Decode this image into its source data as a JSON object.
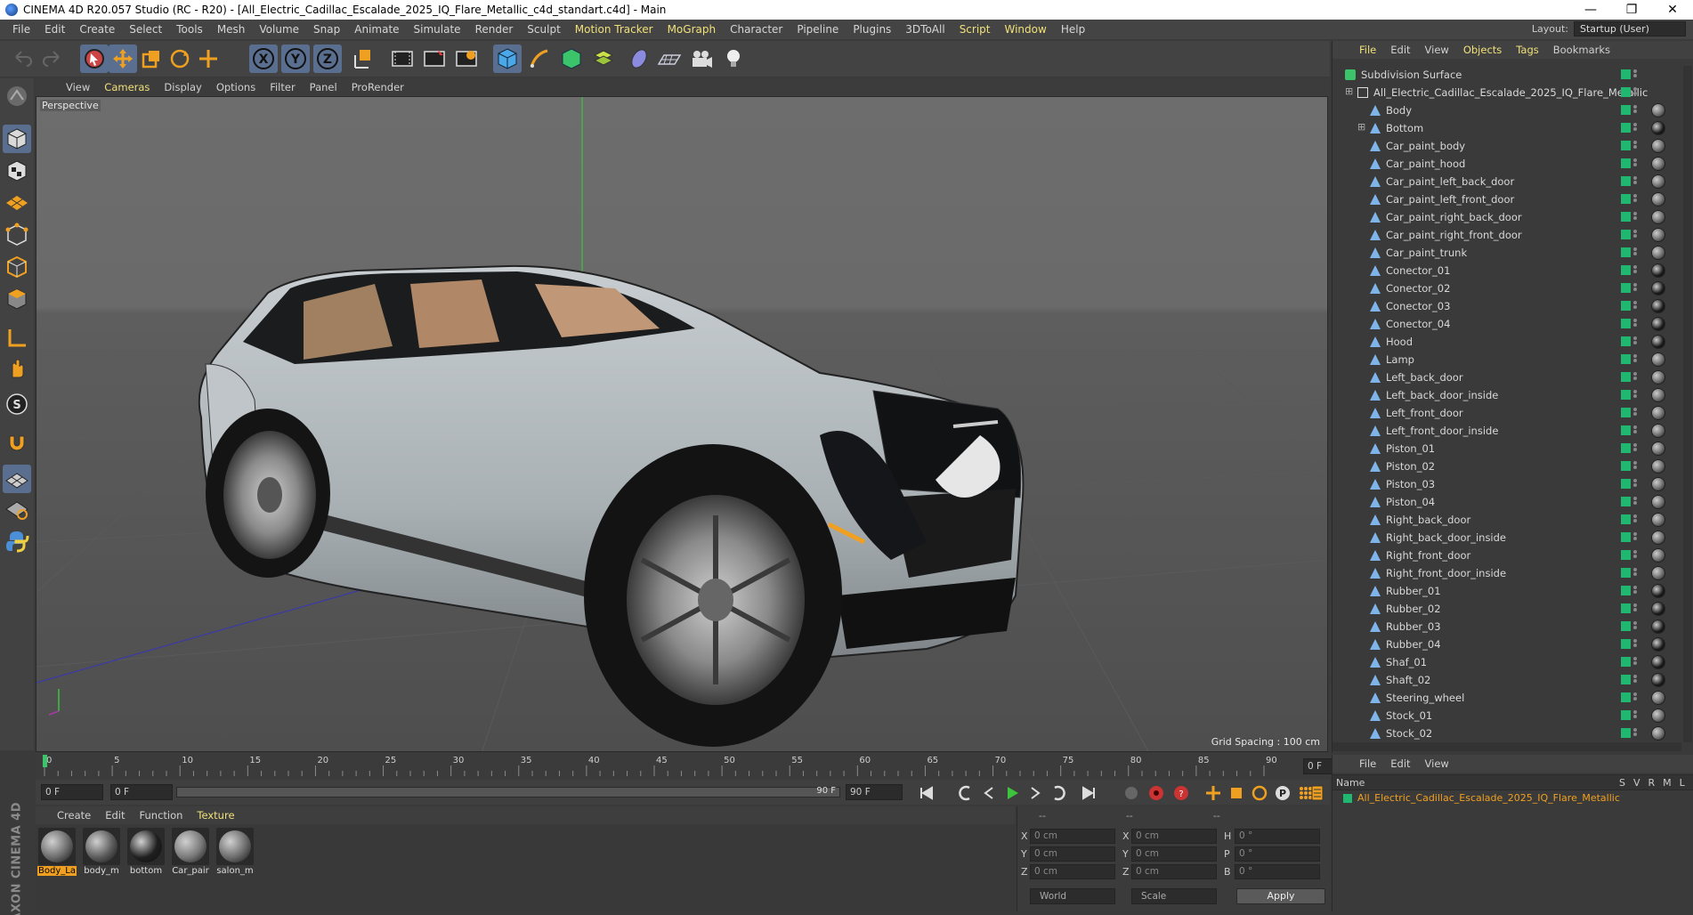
{
  "window": {
    "title": "CINEMA 4D R20.057 Studio (RC - R20) - [All_Electric_Cadillac_Escalade_2025_IQ_Flare_Metallic_c4d_standart.c4d] - Main",
    "controls": {
      "minimize": "—",
      "maximize": "❐",
      "close": "✕"
    }
  },
  "menu": {
    "items": [
      "File",
      "Edit",
      "Create",
      "Select",
      "Tools",
      "Mesh",
      "Volume",
      "Snap",
      "Animate",
      "Simulate",
      "Render",
      "Sculpt",
      "Motion Tracker",
      "MoGraph",
      "Character",
      "Pipeline",
      "Plugins",
      "3DToAll",
      "Script",
      "Window",
      "Help"
    ],
    "highlighted": [
      "Motion Tracker",
      "MoGraph",
      "Script",
      "Window"
    ],
    "layout_label": "Layout:",
    "layout_value": "Startup (User)"
  },
  "main_toolbar": {
    "axis_buttons": [
      "X",
      "Y",
      "Z"
    ],
    "icons": [
      "undo-icon",
      "redo-icon",
      "live-selection-icon",
      "move-icon",
      "scale-icon",
      "rotate-icon",
      "move-plus-icon",
      "x-axis-icon",
      "y-axis-icon",
      "z-axis-icon",
      "coordinate-system-icon",
      "render-view-icon",
      "render-picture-viewer-icon",
      "edit-render-settings-icon",
      "cube-icon",
      "pen-icon",
      "subdivision-icon",
      "mograph-icon",
      "deformer-icon",
      "floor-icon",
      "camera-icon",
      "light-icon"
    ]
  },
  "left_toolbar": {
    "icons": [
      "make-editable-icon",
      "model-mode-icon",
      "texture-mode-icon",
      "workplane-mode-icon",
      "points-mode-icon",
      "edges-mode-icon",
      "polygons-mode-icon",
      "axis-mode-icon",
      "tweak-mode-icon",
      "solo-icon",
      "snap-icon",
      "workplane-grid-icon",
      "locked-workplane-icon",
      "python-icon"
    ]
  },
  "viewport": {
    "menu": [
      "View",
      "Cameras",
      "Display",
      "Options",
      "Filter",
      "Panel",
      "ProRender"
    ],
    "menu_highlighted": "Cameras",
    "camera_label": "Perspective",
    "grid_spacing": "Grid Spacing : 100 cm"
  },
  "timeline": {
    "ticks": [
      "0",
      "5",
      "10",
      "15",
      "20",
      "25",
      "30",
      "35",
      "40",
      "45",
      "50",
      "55",
      "60",
      "65",
      "70",
      "75",
      "80",
      "85",
      "90"
    ],
    "end_frame": "0 F",
    "current_frame": "0 F",
    "range_start": "0 F",
    "range_end": "90 F",
    "max_frame": "90 F"
  },
  "materials": {
    "menu": [
      "Create",
      "Edit",
      "Function",
      "Texture"
    ],
    "items": [
      {
        "label": "Body_La",
        "selected": true,
        "color": "#6a6a6a"
      },
      {
        "label": "body_m",
        "selected": false,
        "color": "#5a5a5a"
      },
      {
        "label": "bottom",
        "selected": false,
        "color": "#1f1f1f"
      },
      {
        "label": "Car_pair",
        "selected": false,
        "color": "#777777"
      },
      {
        "label": "salon_m",
        "selected": false,
        "color": "#6a6a6a"
      }
    ]
  },
  "brand": "MAXON CINEMA 4D",
  "coordinates": {
    "header": [
      "--",
      "--",
      "--"
    ],
    "rows": [
      {
        "ax1": "X",
        "v1": "0 cm",
        "ax2": "X",
        "v2": "0 cm",
        "ax3": "H",
        "v3": "0 °"
      },
      {
        "ax1": "Y",
        "v1": "0 cm",
        "ax2": "Y",
        "v2": "0 cm",
        "ax3": "P",
        "v3": "0 °"
      },
      {
        "ax1": "Z",
        "v1": "0 cm",
        "ax2": "Z",
        "v2": "0 cm",
        "ax3": "B",
        "v3": "0 °"
      }
    ],
    "space": "World",
    "mode": "Scale",
    "apply": "Apply"
  },
  "objects_panel": {
    "tabs": [
      "File",
      "Edit",
      "View",
      "Objects",
      "Tags",
      "Bookmarks"
    ],
    "highlighted_tabs": [
      "File",
      "Objects",
      "Tags"
    ],
    "root": "Subdivision Surface",
    "group": "All_Electric_Cadillac_Escalade_2025_IQ_Flare_Metallic",
    "children": [
      "Body",
      "Bottom",
      "Car_paint_body",
      "Car_paint_hood",
      "Car_paint_left_back_door",
      "Car_paint_left_front_door",
      "Car_paint_right_back_door",
      "Car_paint_right_front_door",
      "Car_paint_trunk",
      "Conector_01",
      "Conector_02",
      "Conector_03",
      "Conector_04",
      "Hood",
      "Lamp",
      "Left_back_door",
      "Left_back_door_inside",
      "Left_front_door",
      "Left_front_door_inside",
      "Piston_01",
      "Piston_02",
      "Piston_03",
      "Piston_04",
      "Right_back_door",
      "Right_back_door_inside",
      "Right_front_door",
      "Right_front_door_inside",
      "Rubber_01",
      "Rubber_02",
      "Rubber_03",
      "Rubber_04",
      "Shaf_01",
      "Shaft_02",
      "Steering_wheel",
      "Stock_01",
      "Stock_02"
    ]
  },
  "attributes_panel": {
    "tabs": [
      "File",
      "Edit",
      "View"
    ],
    "name_header": "Name",
    "columns": [
      "S",
      "V",
      "R",
      "M",
      "L"
    ],
    "row": "All_Electric_Cadillac_Escalade_2025_IQ_Flare_Metallic"
  }
}
